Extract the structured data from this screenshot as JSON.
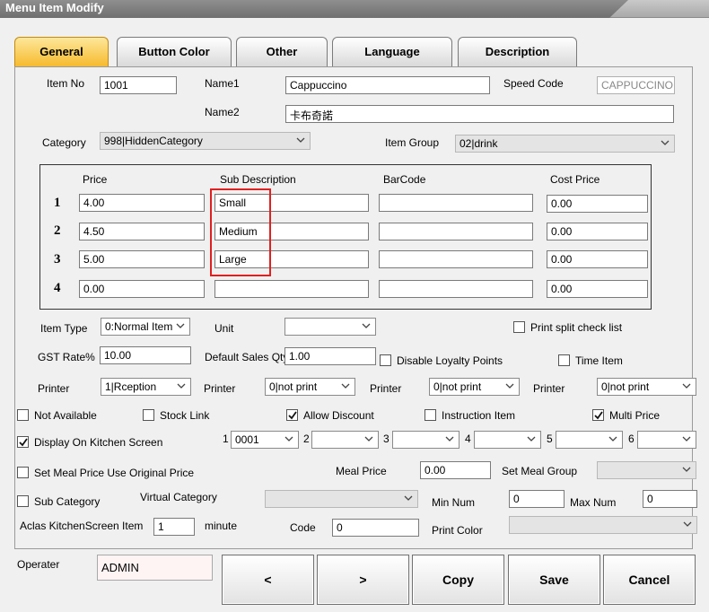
{
  "window": {
    "title": "Menu Item Modify"
  },
  "tabs": [
    {
      "label": "General",
      "active": true
    },
    {
      "label": "Button Color"
    },
    {
      "label": "Other"
    },
    {
      "label": "Language"
    },
    {
      "label": "Description"
    }
  ],
  "form": {
    "item_no_label": "Item No",
    "item_no": "1001",
    "name1_label": "Name1",
    "name1": "Cappuccino",
    "speed_code_label": "Speed Code",
    "speed_code": "CAPPUCCINO",
    "name2_label": "Name2",
    "name2": "卡布奇諾",
    "category_label": "Category",
    "category": "998|HiddenCategory",
    "item_group_label": "Item Group",
    "item_group": "02|drink"
  },
  "price_table": {
    "headers": {
      "price": "Price",
      "sub_description": "Sub Description",
      "barcode": "BarCode",
      "cost_price": "Cost Price"
    },
    "rows": [
      {
        "num": "1",
        "price": "4.00",
        "sub_description": "Small",
        "barcode": "",
        "cost_price": "0.00"
      },
      {
        "num": "2",
        "price": "4.50",
        "sub_description": "Medium",
        "barcode": "",
        "cost_price": "0.00"
      },
      {
        "num": "3",
        "price": "5.00",
        "sub_description": "Large",
        "barcode": "",
        "cost_price": "0.00"
      },
      {
        "num": "4",
        "price": "0.00",
        "sub_description": "",
        "barcode": "",
        "cost_price": "0.00"
      }
    ]
  },
  "settings": {
    "item_type_label": "Item Type",
    "item_type": "0:Normal Item",
    "unit_label": "Unit",
    "unit": "",
    "print_split_label": "Print split check list",
    "gst_label": "GST Rate%",
    "gst": "10.00",
    "default_qty_label": "Default Sales Qty",
    "default_qty": "1.00",
    "disable_loyalty_label": "Disable Loyalty Points",
    "time_item_label": "Time Item",
    "printer_label": "Printer",
    "printers": [
      "1|Rception",
      "0|not print",
      "0|not print",
      "0|not print"
    ],
    "not_available_label": "Not Available",
    "stock_link_label": "Stock Link",
    "allow_discount_label": "Allow Discount",
    "instruction_item_label": "Instruction Item",
    "multi_price_label": "Multi Price",
    "display_kitchen_label": "Display On Kitchen Screen",
    "kitchen_numbers": [
      "1",
      "2",
      "3",
      "4",
      "5",
      "6"
    ],
    "kitchen_values": [
      "0001",
      "",
      "",
      "",
      "",
      ""
    ],
    "set_meal_original_label": "Set Meal Price Use Original Price",
    "meal_price_label": "Meal Price",
    "meal_price": "0.00",
    "set_meal_group_label": "Set Meal Group",
    "set_meal_group": "",
    "sub_category_label": "Sub Category",
    "virtual_category_label": "Virtual Category",
    "virtual_category": "",
    "min_num_label": "Min Num",
    "min_num": "0",
    "max_num_label": "Max Num",
    "max_num": "0",
    "aclas_label": "Aclas KitchenScreen Item",
    "aclas": "1",
    "minute_label": "minute",
    "code_label": "Code",
    "code": "0",
    "print_color_label": "Print Color",
    "print_color": ""
  },
  "footer": {
    "operator_label": "Operater",
    "operator": "ADMIN",
    "prev_label": "<",
    "next_label": ">",
    "copy_label": "Copy",
    "save_label": "Save",
    "cancel_label": "Cancel"
  },
  "checks": {
    "print_split": false,
    "disable_loyalty": false,
    "time_item": false,
    "not_available": false,
    "stock_link": false,
    "allow_discount": true,
    "instruction_item": false,
    "multi_price": true,
    "display_kitchen": true,
    "set_meal_original": false,
    "sub_category": false
  },
  "colors": {
    "accent_tab": "#f6b92a",
    "highlight": "#e02020"
  }
}
